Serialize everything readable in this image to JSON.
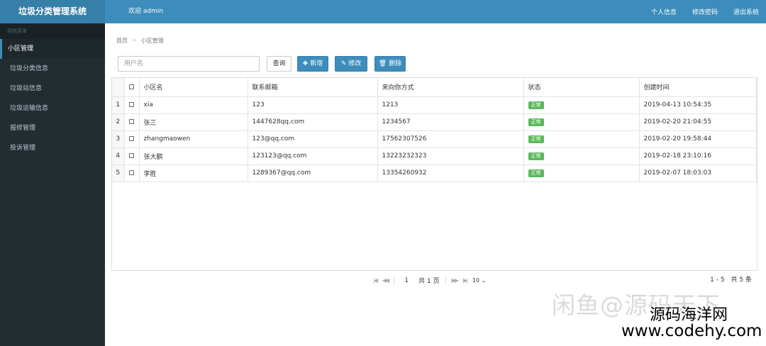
{
  "app": {
    "title": "垃圾分类管理系统",
    "welcome": "欢迎 admin"
  },
  "topnav": {
    "profile": "个人信息",
    "change_password": "修改密码",
    "logout": "退出系统"
  },
  "sidebar": {
    "header": "导航菜单",
    "items": [
      {
        "label": "小区管理"
      },
      {
        "label": "垃圾分类信息"
      },
      {
        "label": "垃圾站信息"
      },
      {
        "label": "垃圾运输信息"
      },
      {
        "label": "报修管理"
      },
      {
        "label": "投诉管理"
      }
    ]
  },
  "breadcrumb": {
    "home": "首页",
    "current": "小区管理"
  },
  "toolbar": {
    "search_placeholder": "用户名",
    "search_label": "查询",
    "add_label": "新增",
    "edit_label": "修改",
    "delete_label": "删除"
  },
  "table": {
    "columns": {
      "name": "小区名",
      "email": "联系邮箱",
      "contact": "来向你方式",
      "status": "状态",
      "created": "创建时间"
    },
    "rows": [
      {
        "n": "1",
        "name": "xia",
        "email": "123",
        "contact": "1213",
        "status": "正常",
        "created": "2019-04-13 10:54:35"
      },
      {
        "n": "2",
        "name": "张三",
        "email": "1447628qq.com",
        "contact": "1234567",
        "status": "正常",
        "created": "2019-02-20 21:04:55"
      },
      {
        "n": "3",
        "name": "zhangmaowen",
        "email": "123@qq.com",
        "contact": "17562307526",
        "status": "正常",
        "created": "2019-02-20 19:58:44"
      },
      {
        "n": "4",
        "name": "张大鹏",
        "email": "123123@qq.com",
        "contact": "13223232323",
        "status": "正常",
        "created": "2019-02-18 23:10:16"
      },
      {
        "n": "5",
        "name": "李胜",
        "email": "1289367@qq.com",
        "contact": "13354260932",
        "status": "正常",
        "created": "2019-02-07 18:03:03"
      }
    ]
  },
  "pager": {
    "page": "1",
    "total_pages_text": "共 1 页",
    "page_size": "10",
    "info": "1 - 5　共 5 条"
  },
  "watermark": {
    "line1": "闲鱼@源码天下",
    "line2": "源码海洋网",
    "line3": "www.codehy.com"
  },
  "colors": {
    "topbar": "#3c8dbc",
    "sidebar": "#222d32",
    "primary_button": "#3c8dbc",
    "status_badge": "#5cb85c"
  }
}
